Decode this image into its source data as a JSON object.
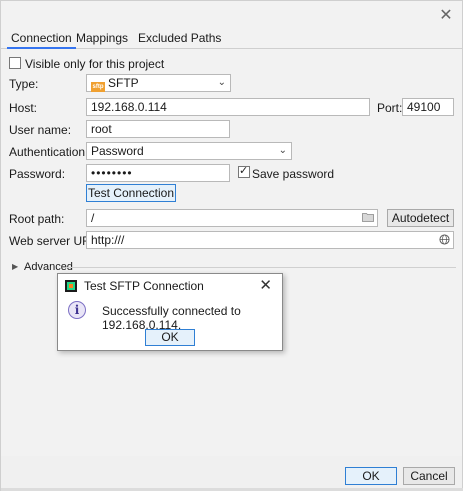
{
  "tabs": [
    {
      "label": "Connection",
      "active": true
    },
    {
      "label": "Mappings",
      "active": false
    },
    {
      "label": "Excluded Paths",
      "active": false
    }
  ],
  "connection": {
    "visible_only_label": "Visible only for this project",
    "visible_only_checked": false,
    "type_label": "Type:",
    "type_value": "SFTP",
    "type_badge": "sftp",
    "host_label": "Host:",
    "host_value": "192.168.0.114",
    "port_label": "Port:",
    "port_value": "49100",
    "username_label": "User name:",
    "username_value": "root",
    "auth_label": "Authentication:",
    "auth_value": "Password",
    "password_label": "Password:",
    "password_value": "••••••••",
    "save_password_label": "Save password",
    "save_password_checked": true,
    "test_connection_label": "Test Connection",
    "root_path_label": "Root path:",
    "root_path_value": "/",
    "autodetect_label": "Autodetect",
    "web_url_label": "Web server URL:",
    "web_url_value": "http:///",
    "advanced_label": "Advanced"
  },
  "dialog": {
    "title": "Test SFTP Connection",
    "message": "Successfully connected to 192.168.0.114.",
    "ok_label": "OK"
  },
  "footer": {
    "ok_label": "OK",
    "cancel_label": "Cancel"
  },
  "colors": {
    "accent": "#3574f0",
    "primary_border": "#2f7fd4",
    "sftp_badge": "#f0a030"
  }
}
